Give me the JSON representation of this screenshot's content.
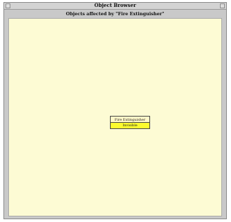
{
  "window": {
    "title": "Object Browser"
  },
  "browser": {
    "subtitle": "Objects affected by \"Fire Extinguisher\""
  },
  "graph": {
    "nodes": [
      {
        "label": "Fire Extinguisher"
      },
      {
        "label": "Invisible"
      }
    ]
  },
  "colors": {
    "canvas": "#fdfbd4",
    "highlight": "#fbfb2f",
    "chrome": "#c9c9c9"
  }
}
